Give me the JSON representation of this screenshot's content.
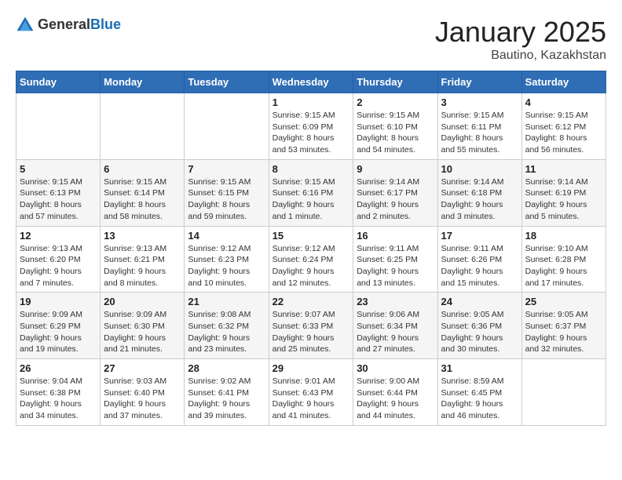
{
  "logo": {
    "general": "General",
    "blue": "Blue"
  },
  "header": {
    "title": "January 2025",
    "subtitle": "Bautino, Kazakhstan"
  },
  "weekdays": [
    "Sunday",
    "Monday",
    "Tuesday",
    "Wednesday",
    "Thursday",
    "Friday",
    "Saturday"
  ],
  "weeks": [
    [
      {
        "day": "",
        "info": ""
      },
      {
        "day": "",
        "info": ""
      },
      {
        "day": "",
        "info": ""
      },
      {
        "day": "1",
        "info": "Sunrise: 9:15 AM\nSunset: 6:09 PM\nDaylight: 8 hours and 53 minutes."
      },
      {
        "day": "2",
        "info": "Sunrise: 9:15 AM\nSunset: 6:10 PM\nDaylight: 8 hours and 54 minutes."
      },
      {
        "day": "3",
        "info": "Sunrise: 9:15 AM\nSunset: 6:11 PM\nDaylight: 8 hours and 55 minutes."
      },
      {
        "day": "4",
        "info": "Sunrise: 9:15 AM\nSunset: 6:12 PM\nDaylight: 8 hours and 56 minutes."
      }
    ],
    [
      {
        "day": "5",
        "info": "Sunrise: 9:15 AM\nSunset: 6:13 PM\nDaylight: 8 hours and 57 minutes."
      },
      {
        "day": "6",
        "info": "Sunrise: 9:15 AM\nSunset: 6:14 PM\nDaylight: 8 hours and 58 minutes."
      },
      {
        "day": "7",
        "info": "Sunrise: 9:15 AM\nSunset: 6:15 PM\nDaylight: 8 hours and 59 minutes."
      },
      {
        "day": "8",
        "info": "Sunrise: 9:15 AM\nSunset: 6:16 PM\nDaylight: 9 hours and 1 minute."
      },
      {
        "day": "9",
        "info": "Sunrise: 9:14 AM\nSunset: 6:17 PM\nDaylight: 9 hours and 2 minutes."
      },
      {
        "day": "10",
        "info": "Sunrise: 9:14 AM\nSunset: 6:18 PM\nDaylight: 9 hours and 3 minutes."
      },
      {
        "day": "11",
        "info": "Sunrise: 9:14 AM\nSunset: 6:19 PM\nDaylight: 9 hours and 5 minutes."
      }
    ],
    [
      {
        "day": "12",
        "info": "Sunrise: 9:13 AM\nSunset: 6:20 PM\nDaylight: 9 hours and 7 minutes."
      },
      {
        "day": "13",
        "info": "Sunrise: 9:13 AM\nSunset: 6:21 PM\nDaylight: 9 hours and 8 minutes."
      },
      {
        "day": "14",
        "info": "Sunrise: 9:12 AM\nSunset: 6:23 PM\nDaylight: 9 hours and 10 minutes."
      },
      {
        "day": "15",
        "info": "Sunrise: 9:12 AM\nSunset: 6:24 PM\nDaylight: 9 hours and 12 minutes."
      },
      {
        "day": "16",
        "info": "Sunrise: 9:11 AM\nSunset: 6:25 PM\nDaylight: 9 hours and 13 minutes."
      },
      {
        "day": "17",
        "info": "Sunrise: 9:11 AM\nSunset: 6:26 PM\nDaylight: 9 hours and 15 minutes."
      },
      {
        "day": "18",
        "info": "Sunrise: 9:10 AM\nSunset: 6:28 PM\nDaylight: 9 hours and 17 minutes."
      }
    ],
    [
      {
        "day": "19",
        "info": "Sunrise: 9:09 AM\nSunset: 6:29 PM\nDaylight: 9 hours and 19 minutes."
      },
      {
        "day": "20",
        "info": "Sunrise: 9:09 AM\nSunset: 6:30 PM\nDaylight: 9 hours and 21 minutes."
      },
      {
        "day": "21",
        "info": "Sunrise: 9:08 AM\nSunset: 6:32 PM\nDaylight: 9 hours and 23 minutes."
      },
      {
        "day": "22",
        "info": "Sunrise: 9:07 AM\nSunset: 6:33 PM\nDaylight: 9 hours and 25 minutes."
      },
      {
        "day": "23",
        "info": "Sunrise: 9:06 AM\nSunset: 6:34 PM\nDaylight: 9 hours and 27 minutes."
      },
      {
        "day": "24",
        "info": "Sunrise: 9:05 AM\nSunset: 6:36 PM\nDaylight: 9 hours and 30 minutes."
      },
      {
        "day": "25",
        "info": "Sunrise: 9:05 AM\nSunset: 6:37 PM\nDaylight: 9 hours and 32 minutes."
      }
    ],
    [
      {
        "day": "26",
        "info": "Sunrise: 9:04 AM\nSunset: 6:38 PM\nDaylight: 9 hours and 34 minutes."
      },
      {
        "day": "27",
        "info": "Sunrise: 9:03 AM\nSunset: 6:40 PM\nDaylight: 9 hours and 37 minutes."
      },
      {
        "day": "28",
        "info": "Sunrise: 9:02 AM\nSunset: 6:41 PM\nDaylight: 9 hours and 39 minutes."
      },
      {
        "day": "29",
        "info": "Sunrise: 9:01 AM\nSunset: 6:43 PM\nDaylight: 9 hours and 41 minutes."
      },
      {
        "day": "30",
        "info": "Sunrise: 9:00 AM\nSunset: 6:44 PM\nDaylight: 9 hours and 44 minutes."
      },
      {
        "day": "31",
        "info": "Sunrise: 8:59 AM\nSunset: 6:45 PM\nDaylight: 9 hours and 46 minutes."
      },
      {
        "day": "",
        "info": ""
      }
    ]
  ]
}
